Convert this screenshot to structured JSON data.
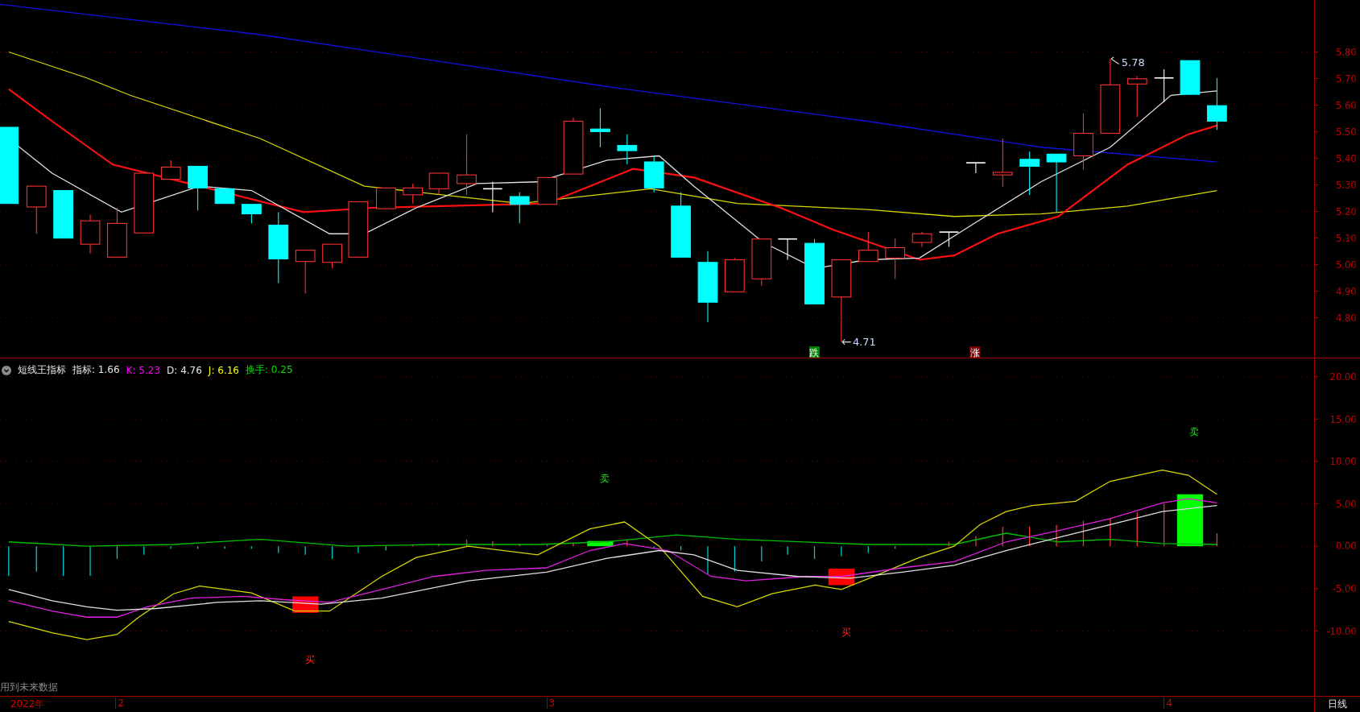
{
  "price_panel": {
    "axis_labels": [
      "5.80",
      "5.70",
      "5.60",
      "5.50",
      "5.40",
      "5.30",
      "5.20",
      "5.10",
      "5.00",
      "4.90",
      "4.80"
    ],
    "high_label": "5.78",
    "low_label": "4.71",
    "signals": [
      {
        "text": "跌",
        "kind": "down"
      },
      {
        "text": "涨",
        "kind": "up"
      }
    ]
  },
  "indicator": {
    "name": "短线王指标",
    "values": [
      {
        "label": "指标: 1.66",
        "color": "#e6e6e6"
      },
      {
        "label": "K: 5.23",
        "color": "#ff00ff"
      },
      {
        "label": "D: 4.76",
        "color": "#e6e6e6"
      },
      {
        "label": "J: 6.16",
        "color": "#ffff00"
      },
      {
        "label": "换手: 0.25",
        "color": "#00e000"
      }
    ],
    "axis_labels": [
      "20.00",
      "15.00",
      "10.00",
      "5.00",
      "0.00",
      "-5.00",
      "-10.00"
    ],
    "signals": [
      {
        "text": "买",
        "kind": "buy"
      },
      {
        "text": "卖",
        "kind": "sell"
      },
      {
        "text": "买",
        "kind": "buy"
      },
      {
        "text": "卖",
        "kind": "sell"
      }
    ],
    "note": "用到未来数据"
  },
  "time_axis": {
    "labels": [
      "2022年",
      "2",
      "3",
      "4"
    ],
    "period": "日线"
  }
}
